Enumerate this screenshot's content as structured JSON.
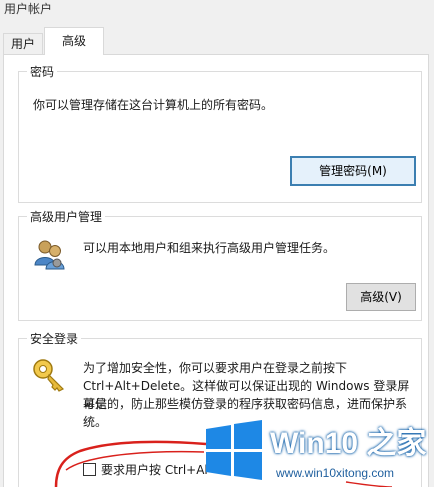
{
  "window": {
    "title": "用户帐户"
  },
  "tabs": [
    {
      "label": "用户"
    },
    {
      "label": "高级"
    }
  ],
  "passwords": {
    "title": "密码",
    "description": "你可以管理存储在这台计算机上的所有密码。",
    "button": "管理密码(M)"
  },
  "advanced_user": {
    "title": "高级用户管理",
    "description": "可以用本地用户和组来执行高级用户管理任务。",
    "button": "高级(V)"
  },
  "secure_logon": {
    "title": "安全登录",
    "line1": "为了增加安全性，你可以要求用户在登录之前按下",
    "line2": "Ctrl+Alt+Delete。这样做可以保证出现的 Windows 登录屏幕是",
    "line3": "可信的，防止那些模仿登录的程序获取密码信息，进而保护系",
    "line4": "统。",
    "checkbox_label": "要求用户按 Ctrl+Al"
  },
  "watermark": {
    "title": "Win10 之家",
    "url": "www.win10xitong.com"
  },
  "colors": {
    "accent_focus": "#3c7fb1",
    "win_logo": "#1e88e5",
    "annotation": "#d9211c"
  }
}
